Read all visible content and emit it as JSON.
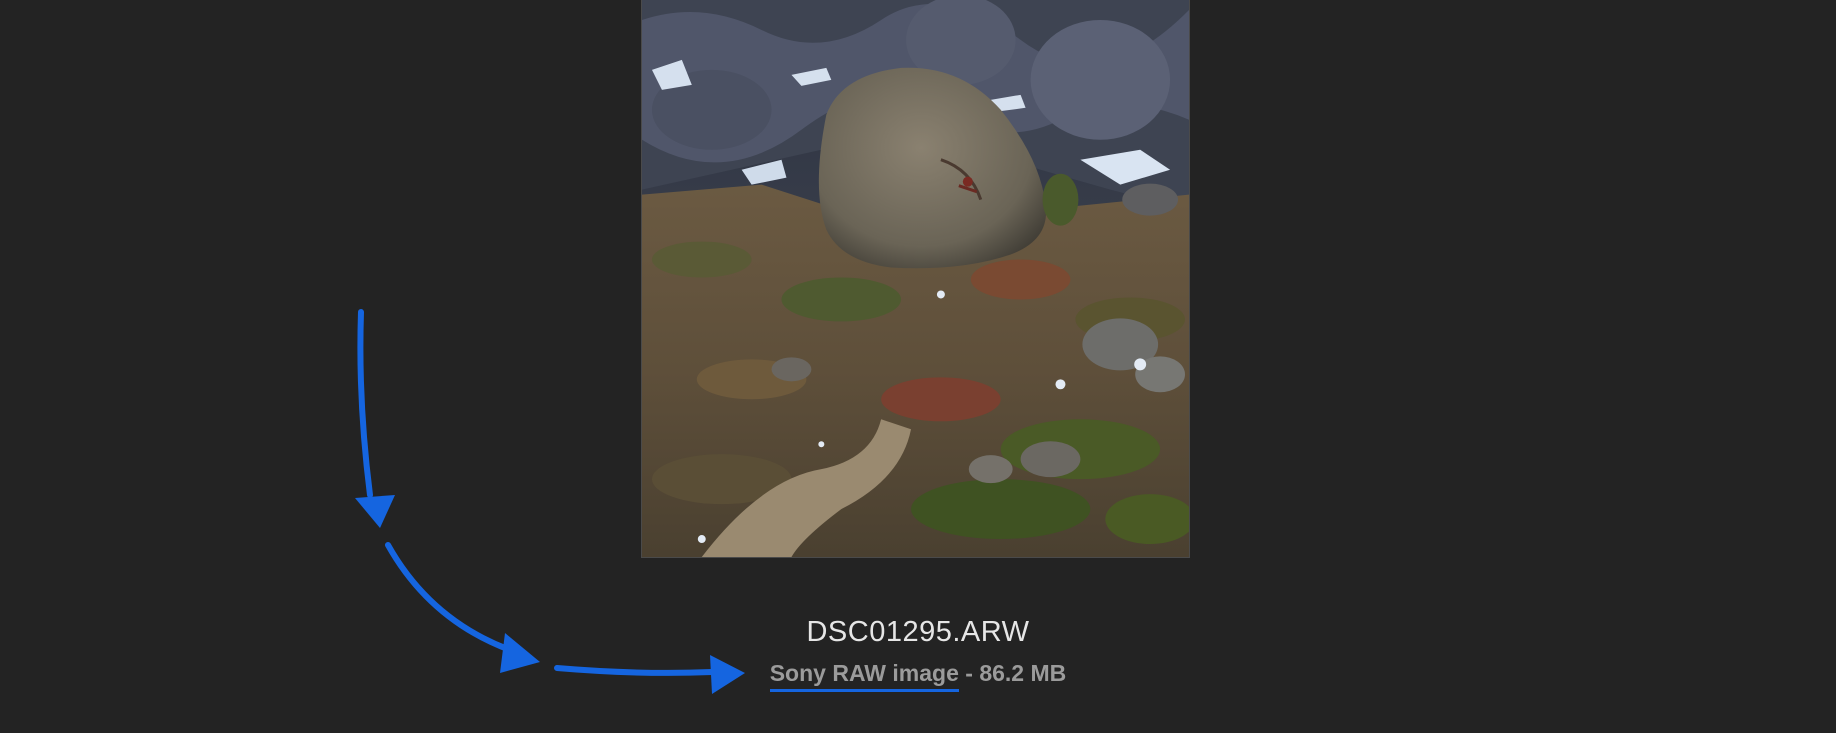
{
  "file": {
    "name": "DSC01295.ARW",
    "kind": "Sony RAW image",
    "separator": " - ",
    "size": "86.2 MB"
  },
  "preview": {
    "subject": "desert boulder landscape with snow-dusted rocky hills"
  },
  "annotation": {
    "arrow_color": "#1565e0",
    "underline_color": "#1565e0"
  },
  "colors": {
    "background": "#232323",
    "filename_text": "#e6e6e6",
    "meta_text": "#9b9b9b"
  }
}
